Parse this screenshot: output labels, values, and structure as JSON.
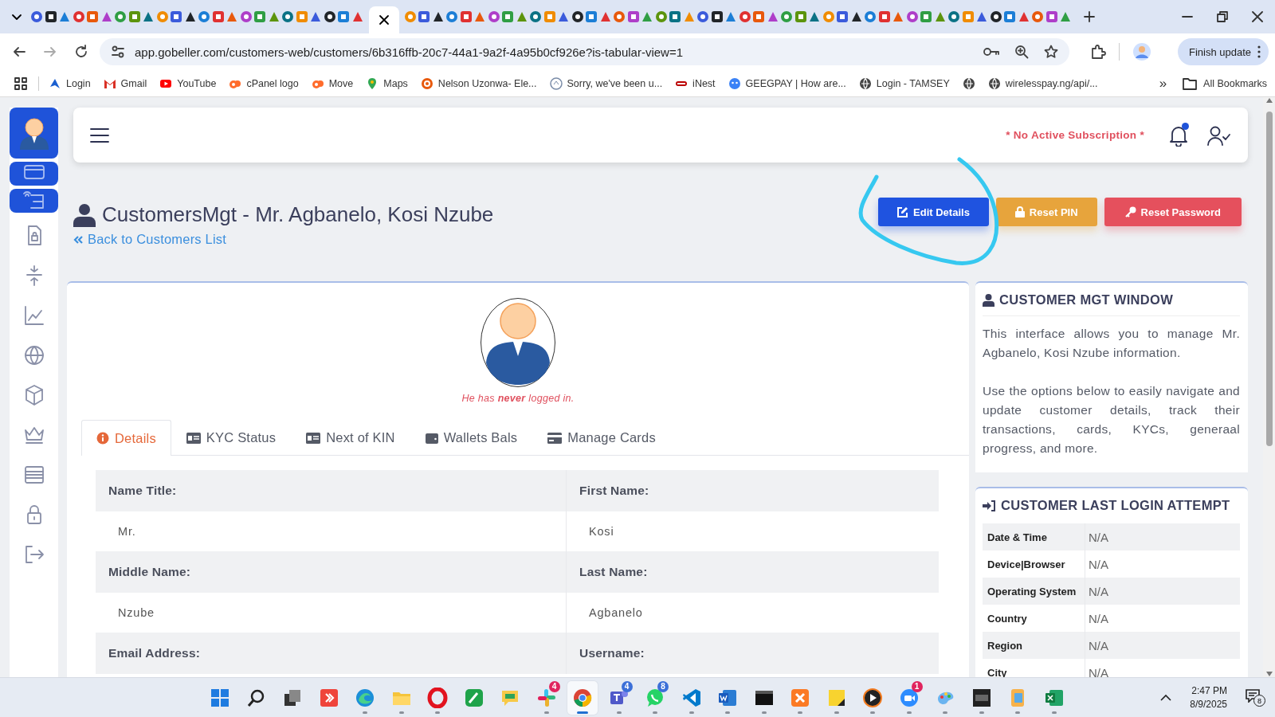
{
  "browser": {
    "address_bar": {
      "url": "app.gobeller.com/customers-web/customers/6b316ffb-20c7-44a1-9a2f-4a95b0cf926e?is-tabular-view=1"
    },
    "update_button": "Finish update",
    "bookmarks": [
      {
        "kind": "link",
        "label": "Login"
      },
      {
        "kind": "link",
        "label": "Gmail"
      },
      {
        "kind": "link",
        "label": "YouTube"
      },
      {
        "kind": "link",
        "label": "cPanel logo"
      },
      {
        "kind": "link",
        "label": "Move"
      },
      {
        "kind": "link",
        "label": "Maps"
      },
      {
        "kind": "link",
        "label": "Nelson Uzonwa- Ele..."
      },
      {
        "kind": "link",
        "label": "Sorry, we've been u..."
      },
      {
        "kind": "link",
        "label": "iNest"
      },
      {
        "kind": "link",
        "label": "GEEGPAY | How are..."
      },
      {
        "kind": "link",
        "label": "Login - TAMSEY"
      },
      {
        "kind": "icon"
      },
      {
        "kind": "link",
        "label": "wirelesspay.ng/api/..."
      }
    ],
    "more_bookmarks": "»",
    "all_bookmarks": "All Bookmarks"
  },
  "sidebar": {
    "items": [
      {
        "selected": true
      },
      {
        "selected": true
      },
      {
        "selected": true
      },
      {
        "selected": false
      },
      {
        "selected": false
      },
      {
        "selected": false
      },
      {
        "selected": false
      },
      {
        "selected": false
      },
      {
        "selected": false
      },
      {
        "selected": false
      },
      {
        "selected": false
      },
      {
        "selected": false
      }
    ]
  },
  "topbar": {
    "subscription_notice": "* No Active Subscription *",
    "notifications": {
      "unread": true
    }
  },
  "header": {
    "title": "CustomersMgt - Mr. Agbanelo, Kosi Nzube",
    "back_link": "Back to Customers List",
    "buttons": [
      {
        "kind": "primary",
        "label": "Edit Details"
      },
      {
        "kind": "warning",
        "label": "Reset PIN"
      },
      {
        "kind": "danger",
        "label": "Reset Password"
      }
    ]
  },
  "profile": {
    "login_note": "He has **never** logged in.",
    "tabs": [
      {
        "label": "Details",
        "selected": true
      },
      {
        "label": "KYC Status",
        "selected": false
      },
      {
        "label": "Next of KIN",
        "selected": false
      },
      {
        "label": "Wallets Bals",
        "selected": false
      },
      {
        "label": "Manage Cards",
        "selected": false
      }
    ],
    "fields": [
      {
        "label": "Name Title:",
        "value": "Mr."
      },
      {
        "label": "First Name:",
        "value": "Kosi"
      },
      {
        "label": "Middle Name:",
        "value": "Nzube"
      },
      {
        "label": "Last Name:",
        "value": "Agbanelo"
      },
      {
        "label": "Email Address:"
      },
      {
        "label": "Username:"
      }
    ]
  },
  "info_panel": {
    "title": "CUSTOMER MGT WINDOW",
    "paragraphs": [
      "This interface allows you to manage Mr. Agbanelo, Kosi Nzube information.",
      "Use the options below to easily navigate and update customer details, track their transactions, cards, KYCs, generaal progress, and more."
    ]
  },
  "last_login": {
    "title": "CUSTOMER LAST LOGIN ATTEMPT",
    "rows": [
      {
        "label": "Date & Time",
        "value": "N/A"
      },
      {
        "label": "Device|Browser",
        "value": "N/A"
      },
      {
        "label": "Operating System",
        "value": "N/A"
      },
      {
        "label": "Country",
        "value": "N/A"
      },
      {
        "label": "Region",
        "value": "N/A"
      },
      {
        "label": "City",
        "value": "N/A"
      }
    ]
  },
  "taskbar": {
    "apps": [
      {
        "running": false,
        "selected": false
      },
      {
        "running": false,
        "selected": false
      },
      {
        "running": false,
        "selected": false
      },
      {
        "running": false,
        "selected": false
      },
      {
        "running": true,
        "selected": false
      },
      {
        "running": true,
        "selected": false
      },
      {
        "running": true,
        "selected": false
      },
      {
        "running": false,
        "selected": false
      },
      {
        "running": false,
        "selected": false
      },
      {
        "running": true,
        "selected": false,
        "badge": "4",
        "color": "#e0245e"
      },
      {
        "running": true,
        "selected": true
      },
      {
        "running": true,
        "selected": false,
        "badge": "4",
        "color": "#3b6fd8"
      },
      {
        "running": true,
        "selected": false,
        "badge": "8",
        "color": "#3b6fd8"
      },
      {
        "running": true,
        "selected": false
      },
      {
        "running": true,
        "selected": false
      },
      {
        "running": true,
        "selected": false
      },
      {
        "running": true,
        "selected": false
      },
      {
        "running": true,
        "selected": false
      },
      {
        "running": true,
        "selected": false
      },
      {
        "running": true,
        "selected": false,
        "badge": "1",
        "color": "#e0245e"
      },
      {
        "running": true,
        "selected": false
      },
      {
        "running": true,
        "selected": false
      },
      {
        "running": true,
        "selected": false
      },
      {
        "running": true,
        "selected": false
      }
    ],
    "time": "2:47 PM",
    "date": "8/9/2025",
    "notification_count": "8"
  }
}
